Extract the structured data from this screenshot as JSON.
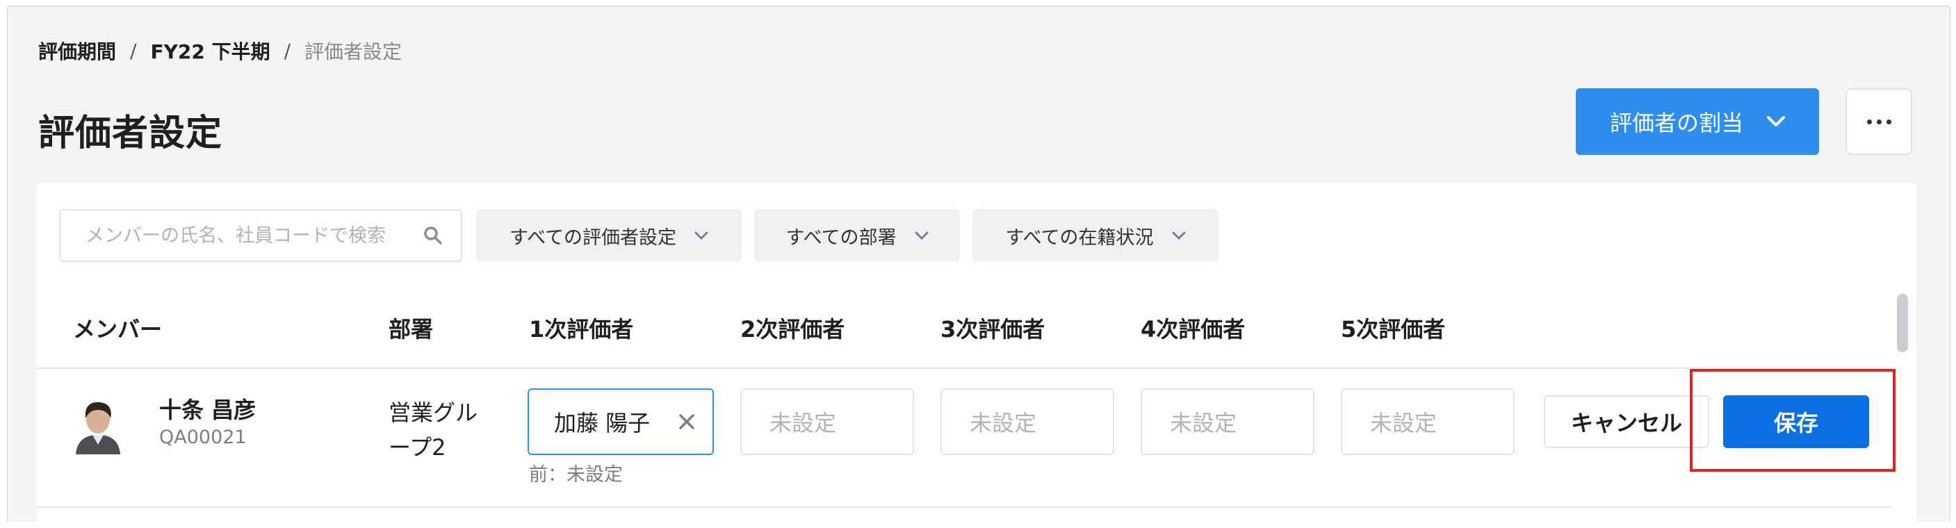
{
  "breadcrumb": {
    "items": [
      "評価期間",
      "FY22 下半期"
    ],
    "separator": "/",
    "current": "評価者設定"
  },
  "page": {
    "title": "評価者設定"
  },
  "header_actions": {
    "assign_button": "評価者の割当",
    "more_icon": "more-horizontal-icon"
  },
  "filters": {
    "search_placeholder": "メンバーの氏名、社員コードで検索",
    "evaluator_setting": "すべての評価者設定",
    "department": "すべての部署",
    "status": "すべての在籍状況"
  },
  "table": {
    "columns": [
      "メンバー",
      "部署",
      "1次評価者",
      "2次評価者",
      "3次評価者",
      "4次評価者",
      "5次評価者"
    ],
    "rows": [
      {
        "name": "十条 昌彦",
        "code": "QA00021",
        "department": "営業グループ2",
        "evaluator1": "加藤 陽子",
        "evaluator1_previous": "前：未設定",
        "evaluator2": "未設定",
        "evaluator3": "未設定",
        "evaluator4": "未設定",
        "evaluator5": "未設定"
      }
    ]
  },
  "row_actions": {
    "cancel": "キャンセル",
    "save": "保存"
  },
  "colors": {
    "primary": "#2d8ef0",
    "save": "#0a6fe0",
    "highlight": "#e0231b"
  }
}
